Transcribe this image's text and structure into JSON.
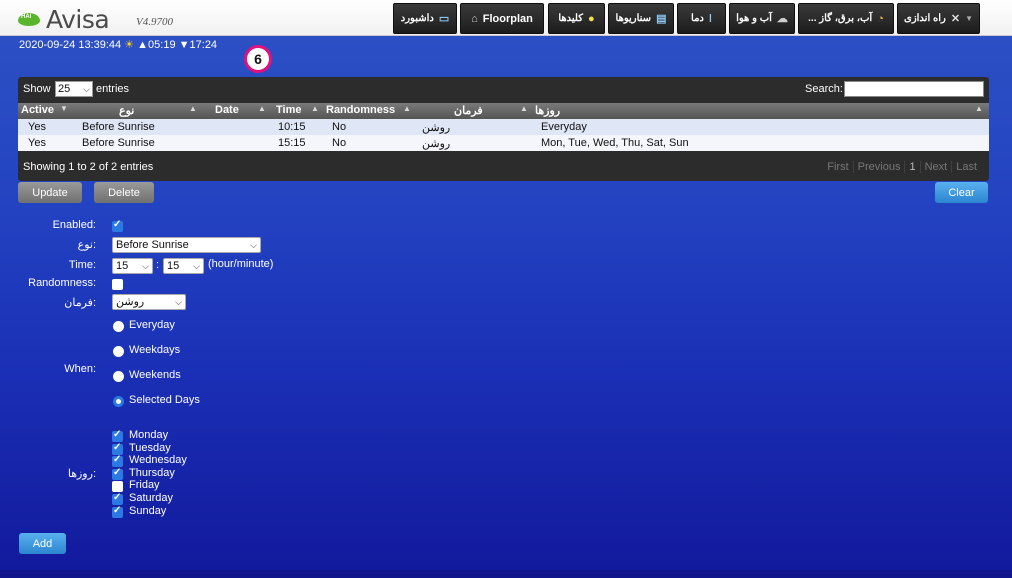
{
  "header": {
    "logo_badge": "HAI",
    "app_name": "Avisa",
    "version": "V4.9700",
    "nav": [
      {
        "label": "داشبورد",
        "icon": "monitor-icon"
      },
      {
        "label": "Floorplan",
        "icon": "home-icon"
      },
      {
        "label": "کلیدها",
        "icon": "bulb-icon"
      },
      {
        "label": "سناریوها",
        "icon": "clapper-icon"
      },
      {
        "label": "دما",
        "icon": "thermometer-icon"
      },
      {
        "label": "آب و هوا",
        "icon": "cloud-icon"
      },
      {
        "label": "... آب، برق، گاز",
        "icon": "gauge-icon"
      },
      {
        "label": "راه اندازی",
        "icon": "tools-icon"
      }
    ]
  },
  "status": {
    "datetime": "2020-09-24 13:39:44",
    "sunrise": "▲05:19",
    "sunset": "▼17:24",
    "badge": "6"
  },
  "table": {
    "show_label": "Show",
    "page_size": "25",
    "entries_label": "entries",
    "search_label": "Search:",
    "search_value": "",
    "columns": [
      "Active",
      "نوع",
      "Date",
      "Time",
      "Randomness",
      "فرمان",
      "روزها"
    ],
    "rows": [
      {
        "active": "Yes",
        "type": "Before Sunrise",
        "date": "",
        "time": "10:15",
        "randomness": "No",
        "command": "روشن",
        "days": "Everyday"
      },
      {
        "active": "Yes",
        "type": "Before Sunrise",
        "date": "",
        "time": "15:15",
        "randomness": "No",
        "command": "روشن",
        "days": "Mon, Tue, Wed, Thu, Sat, Sun"
      }
    ],
    "showing": "Showing 1 to 2 of 2 entries",
    "pager": {
      "first": "First",
      "previous": "Previous",
      "page": "1",
      "next": "Next",
      "last": "Last"
    }
  },
  "buttons": {
    "update": "Update",
    "delete": "Delete",
    "clear": "Clear",
    "add": "Add"
  },
  "form": {
    "enabled_label": "Enabled:",
    "enabled": true,
    "type_label": "نوع:",
    "type_value": "Before Sunrise",
    "time_label": "Time:",
    "hour": "15",
    "minute": "15",
    "time_sep": ":",
    "time_hint": "(hour/minute)",
    "randomness_label": "Randomness:",
    "randomness": false,
    "command_label": "فرمان:",
    "command_value": "روشن",
    "when_label": "When:",
    "when_options": [
      "Everyday",
      "Weekdays",
      "Weekends",
      "Selected Days"
    ],
    "when_selected": "Selected Days",
    "days_label": "روزها:",
    "days": [
      {
        "label": "Monday",
        "checked": true
      },
      {
        "label": "Tuesday",
        "checked": true
      },
      {
        "label": "Wednesday",
        "checked": true
      },
      {
        "label": "Thursday",
        "checked": true
      },
      {
        "label": "Friday",
        "checked": false
      },
      {
        "label": "Saturday",
        "checked": true
      },
      {
        "label": "Sunday",
        "checked": true
      }
    ]
  },
  "colors": {
    "accent": "#2b79e3",
    "badge_ring": "#e0107c",
    "sun": "#f6d21a"
  }
}
